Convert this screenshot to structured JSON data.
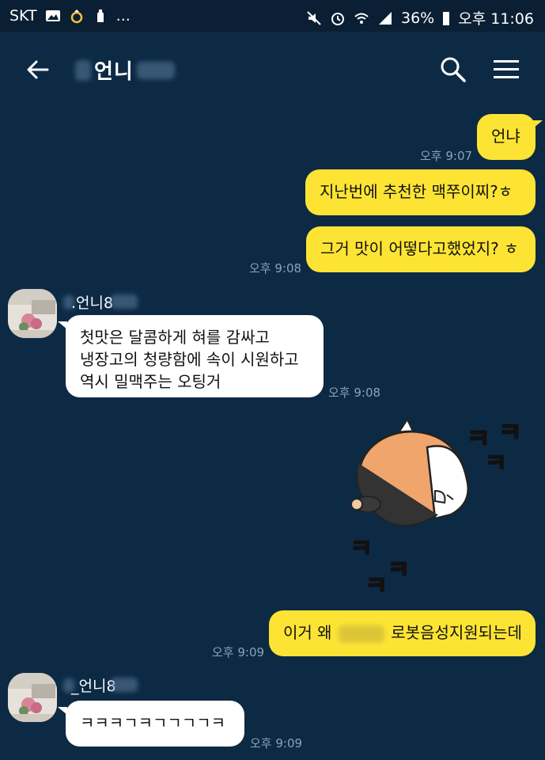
{
  "status_bar": {
    "carrier": "SKT",
    "extra": "...",
    "battery": "36%",
    "time": "오후 11:06"
  },
  "header": {
    "title": "언니",
    "search_icon": "search-icon",
    "menu_icon": "menu-icon",
    "back_icon": "back-arrow-icon"
  },
  "messages": {
    "m1": {
      "text": "언냐",
      "time": "오후 9:07"
    },
    "m2": {
      "text": "지난번에 추천한  맥쭈이찌?ㅎ"
    },
    "m3": {
      "text": "그거 맛이 어떻다고했었지? ㅎ",
      "time": "오후 9:08"
    },
    "m4": {
      "sender": ".언니8",
      "lines": [
        "첫맛은 달콤하게 혀를 감싸고",
        "냉장고의 청량함에 속이 시원하고",
        "역시 밀맥주는 오팅거"
      ],
      "time": "오후 9:08"
    },
    "sticker": {
      "text_top": "ㅋㅋㅋ",
      "text_bottom": "ㅋㅋㅋ"
    },
    "m5": {
      "pre": "이거 왜",
      "post": "로봇음성지원되는데",
      "time": "오후 9:09"
    },
    "m6": {
      "sender": "_언니8",
      "text": "ㅋㅋㅋㄱㅋㄱㄱㄱㄱㅋ",
      "time": "오후 9:09"
    }
  },
  "colors": {
    "background": "#0d2a45",
    "my_bubble": "#fde434",
    "other_bubble": "#ffffff",
    "time_text": "#8da2b5"
  }
}
